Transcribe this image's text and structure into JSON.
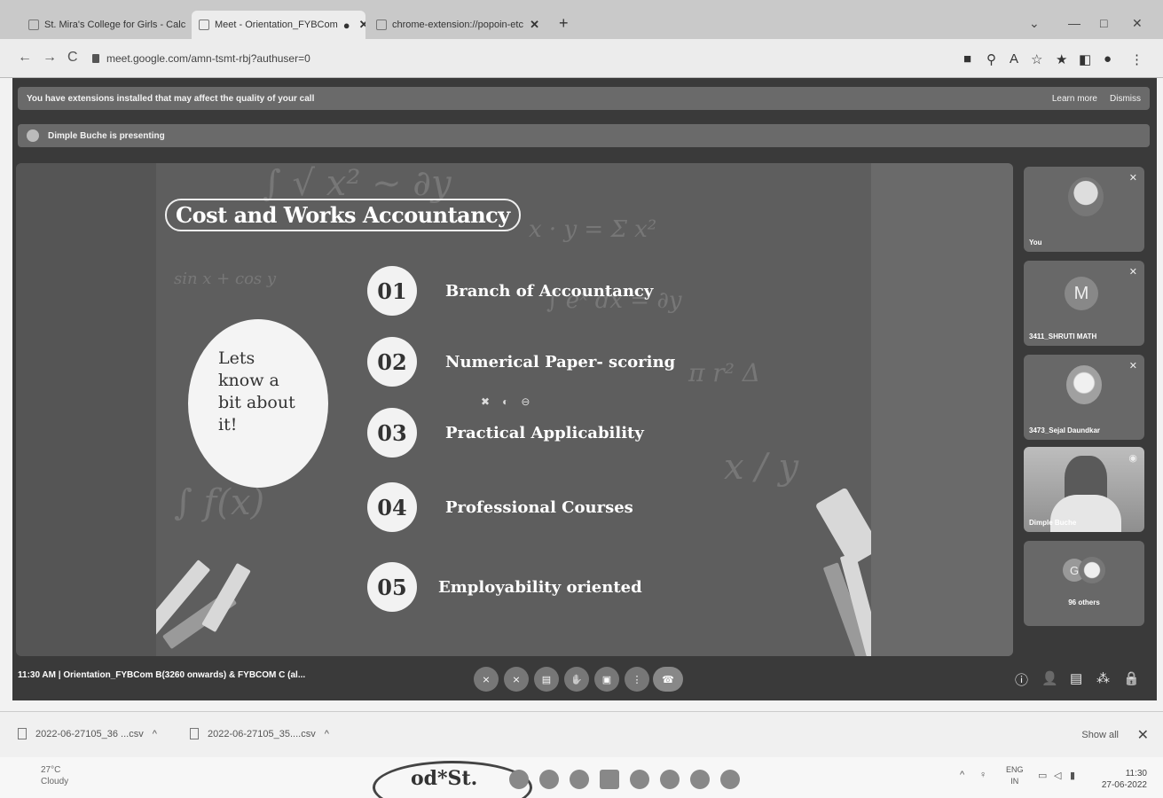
{
  "browser": {
    "tabs": [
      {
        "label": "St. Mira's College for Girls - Calc"
      },
      {
        "label": "Meet - Orientation_FYBCom"
      },
      {
        "label": "chrome-extension://popoin-etc"
      }
    ],
    "url": "meet.google.com/amn-tsmt-rbj?authuser=0"
  },
  "meet": {
    "extension_warning": "You have extensions installed that may affect the quality of your call",
    "learn_more": "Learn more",
    "dismiss": "Dismiss",
    "presenting": "Dimple Buche is presenting",
    "slide": {
      "title": "Cost and Works Accountancy",
      "bubble_lines": [
        "Lets",
        "know a",
        "bit about",
        "it!"
      ],
      "points": [
        {
          "num": "01",
          "text": "Branch of Accountancy"
        },
        {
          "num": "02",
          "text": "Numerical Paper- scoring"
        },
        {
          "num": "03",
          "text": "Practical Applicability"
        },
        {
          "num": "04",
          "text": "Professional Courses"
        },
        {
          "num": "05",
          "text": "Employability oriented"
        }
      ]
    },
    "participants": [
      {
        "name": "You",
        "initial": ""
      },
      {
        "name": "3411_SHRUTI MATH",
        "initial": "M"
      },
      {
        "name": "3473_Sejal Daundkar",
        "initial": ""
      },
      {
        "name": "Dimple Buche",
        "initial": ""
      },
      {
        "name": "96 others",
        "initial": "G"
      }
    ],
    "time": "11:30 AM",
    "meeting_title": "Orientation_FYBCom B(3260 onwards) & FYBCOM C (al..."
  },
  "downloads": {
    "files": [
      "2022-06-27105_36 ...csv",
      "2022-06-27105_35....csv"
    ],
    "show_all": "Show all"
  },
  "taskbar": {
    "temperature": "27°C",
    "weather": "Cloudy",
    "lang": "ENG",
    "region": "IN",
    "time": "11:30",
    "date": "27-06-2022",
    "stamp_text": "od*St."
  }
}
